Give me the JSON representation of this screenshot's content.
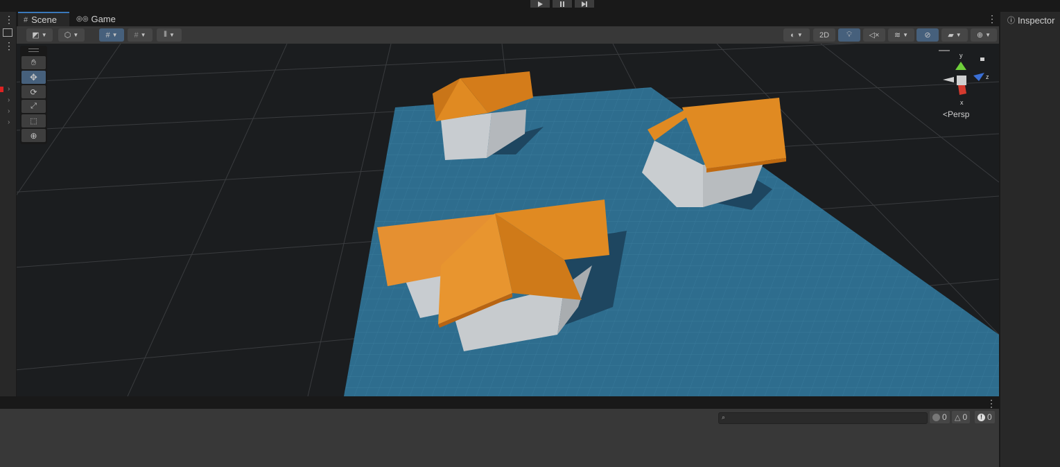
{
  "tabs": {
    "scene": "Scene",
    "game": "Game"
  },
  "inspector": {
    "title": "Inspector"
  },
  "scene_toolbar": {
    "mode_2d": "2D"
  },
  "gizmo": {
    "persp": "Persp",
    "axis_x": "x",
    "axis_y": "y",
    "axis_z": "z"
  },
  "console": {
    "search_placeholder": "",
    "info_count": "0",
    "warning_count": "0",
    "error_count": "0"
  },
  "tools": [
    "hand-tool",
    "move-tool",
    "rotate-tool",
    "scale-tool",
    "rect-tool",
    "transform-tool"
  ],
  "colors": {
    "accent": "#46607c",
    "plane": "#2e6d8e",
    "roof": "#e08a22",
    "walls": "#c9cdd0"
  }
}
